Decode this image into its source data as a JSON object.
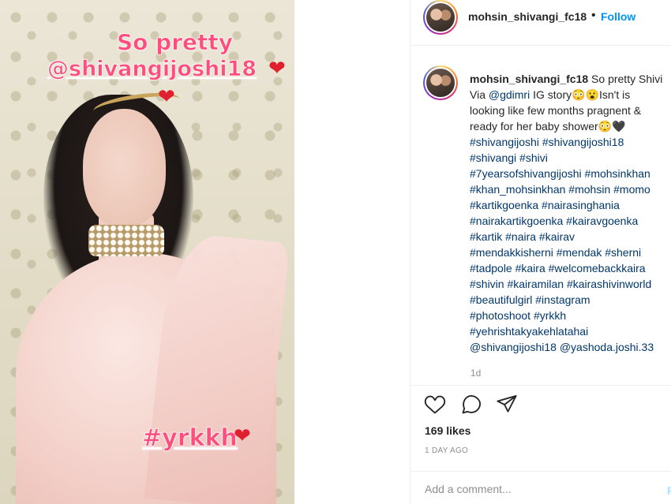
{
  "story": {
    "line1": "So pretty",
    "line2": "@shivangijoshi18",
    "heart": "❤",
    "hashtag": "#yrkkh"
  },
  "header": {
    "username": "mohsin_shivangi_fc18",
    "separator": "•",
    "follow_label": "Follow"
  },
  "caption": {
    "username": "mohsin_shivangi_fc18",
    "lines": [
      " So pretty Shivi",
      "Via ",
      "@gdimri",
      " IG story😳😮Isn't is",
      "looking like few months pragnent &",
      "ready for her baby shower😳🖤",
      "#shivangijoshi #shivangijoshi18",
      "#shivangi #shivi",
      "#7yearsofshivangijoshi #mohsinkhan",
      "#khan_mohsinkhan #mohsin #momo",
      "#kartikgoenka #nairasinghania",
      "#nairakartikgoenka #kairavgoenka",
      "#kartik #naira #kairav",
      "#mendakkisherni #mendak #sherni",
      "#tadpole #kaira #welcomebackkaira",
      "#shivin #kairamilan #kairashivinworld",
      "#beautifulgirl #instagram",
      "#photoshoot #yrkkh",
      "#yehrishtakyakehlatahai",
      "@shivangijoshi18 @yashoda.joshi.33"
    ],
    "time_ago": "1d"
  },
  "actions": {
    "like_icon": "heart-outline-icon",
    "comment_icon": "comment-icon",
    "share_icon": "paper-plane-icon"
  },
  "likes": "169 likes",
  "date": "1 DAY AGO",
  "comment_box": {
    "placeholder": "Add a comment...",
    "post_label": "P"
  },
  "colors": {
    "follow_blue": "#0095f6",
    "link_navy": "#00376b",
    "story_pink": "#ff4d7d",
    "heart_red": "#e0202e"
  }
}
